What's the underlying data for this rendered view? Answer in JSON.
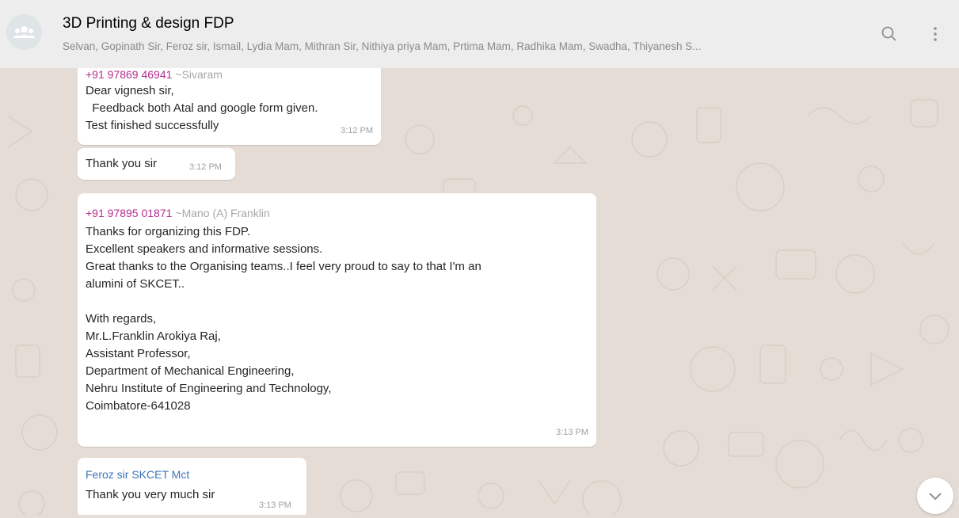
{
  "header": {
    "title": "3D Printing & design FDP",
    "participants": "Selvan, Gopinath Sir, Feroz sir, Ismail, Lydia Mam, Mithran Sir, Nithiya priya Mam, Prtima Mam, Radhika Mam, Swadha, Thiyanesh S..."
  },
  "messages": [
    {
      "phone": "+91 97869 46941",
      "alias": "~Sivaram",
      "lines": [
        "Dear vignesh sir,",
        "  Feedback both Atal and google form given.",
        "Test finished successfully"
      ],
      "time": "3:12 PM"
    },
    {
      "lines": [
        "Thank you sir"
      ],
      "time": "3:12 PM"
    },
    {
      "phone": "+91 97895 01871",
      "alias": "~Mano (A) Franklin",
      "lines": [
        "Thanks for organizing this FDP.",
        "Excellent speakers and informative sessions.",
        "Great thanks to the Organising teams..I feel very proud to say to that I'm an",
        "alumini of SKCET..",
        "",
        "With regards,",
        "Mr.L.Franklin Arokiya Raj,",
        "Assistant Professor,",
        "Department of Mechanical Engineering,",
        "Nehru Institute of Engineering and Technology,",
        "Coimbatore-641028"
      ],
      "time": "3:13 PM"
    },
    {
      "sender": "Feroz sir SKCET Mct",
      "lines": [
        "Thank you very much sir"
      ],
      "time": "3:13 PM"
    }
  ],
  "icons": {
    "avatar": "group-avatar-icon",
    "search": "search-icon",
    "menu": "menu-dots-icon",
    "scroll": "chevron-down-icon"
  },
  "colors": {
    "header_bg": "#ededed",
    "chat_bg": "#e5ddd5",
    "phone": "#b52f8e",
    "sender_blue": "#3b74b8"
  }
}
